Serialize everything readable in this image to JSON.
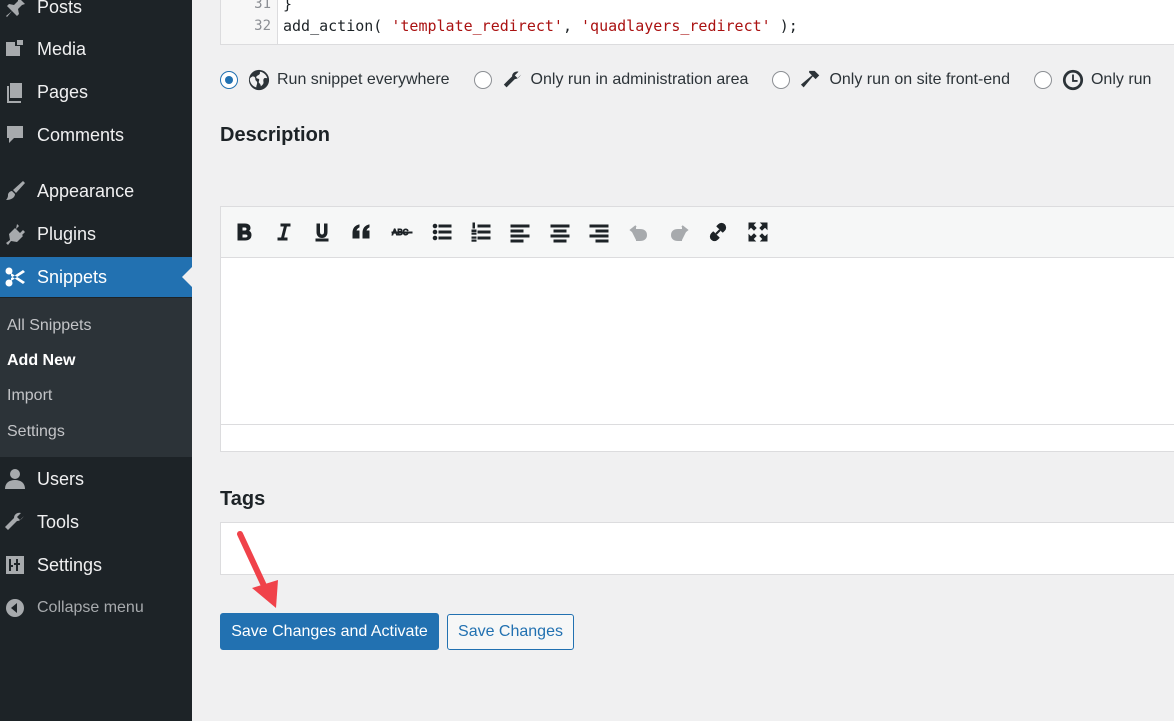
{
  "sidebar": {
    "items": [
      {
        "label": "Posts",
        "icon": "pin-icon"
      },
      {
        "label": "Media",
        "icon": "media-icon"
      },
      {
        "label": "Pages",
        "icon": "pages-icon"
      },
      {
        "label": "Comments",
        "icon": "comment-icon"
      },
      {
        "label": "Appearance",
        "icon": "brush-icon"
      },
      {
        "label": "Plugins",
        "icon": "plugin-icon"
      },
      {
        "label": "Snippets",
        "icon": "scissors-icon",
        "current": true
      },
      {
        "label": "Users",
        "icon": "user-icon"
      },
      {
        "label": "Tools",
        "icon": "wrench-icon"
      },
      {
        "label": "Settings",
        "icon": "sliders-icon"
      }
    ],
    "submenu": [
      "All Snippets",
      "Add New",
      "Import",
      "Settings"
    ],
    "submenu_active": "Add New",
    "collapse_label": "Collapse menu"
  },
  "code": {
    "lines": [
      {
        "num": "31",
        "text": "}"
      },
      {
        "num": "32",
        "prefix": "add_action( ",
        "str1": "'template_redirect'",
        "mid": ", ",
        "str2": "'quadlayers_redirect'",
        "suffix": " );"
      }
    ]
  },
  "scope": {
    "options": [
      {
        "label": "Run snippet everywhere",
        "icon": "globe-icon",
        "checked": true
      },
      {
        "label": "Only run in administration area",
        "icon": "wrench-icon",
        "checked": false
      },
      {
        "label": "Only run on site front-end",
        "icon": "hammer-icon",
        "checked": false
      },
      {
        "label": "Only run",
        "icon": "clock-icon",
        "checked": false
      }
    ]
  },
  "description": {
    "title": "Description",
    "toolbar": [
      "bold-icon",
      "italic-icon",
      "underline-icon",
      "blockquote-icon",
      "strikethrough-icon",
      "bullet-list-icon",
      "numbered-list-icon",
      "align-left-icon",
      "align-center-icon",
      "align-right-icon",
      "undo-icon",
      "redo-icon",
      "link-icon",
      "fullscreen-icon"
    ]
  },
  "tags": {
    "title": "Tags",
    "value": ""
  },
  "actions": {
    "save_activate": "Save Changes and Activate",
    "save": "Save Changes"
  },
  "colors": {
    "accent": "#2271b1",
    "sidebar_bg": "#1d2327",
    "submenu_bg": "#2c3338",
    "annotation_arrow": "#f0424a"
  }
}
